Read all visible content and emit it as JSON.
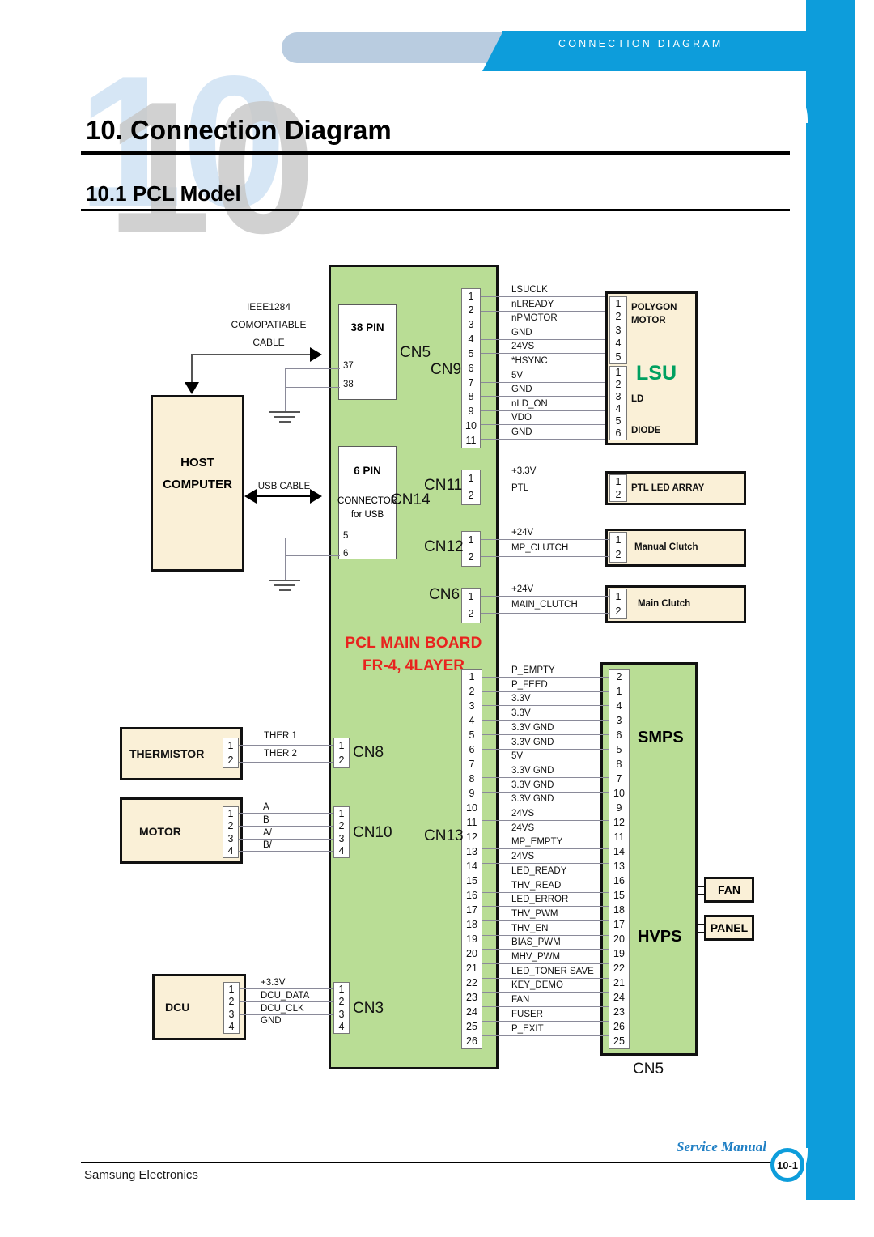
{
  "header": {
    "banner_text": "CONNECTION DIAGRAM",
    "watermark": "10",
    "title": "10. Connection Diagram",
    "subtitle": "10.1 PCL Model"
  },
  "footer": {
    "company": "Samsung Electronics",
    "manual": "Service Manual",
    "page": "10-1"
  },
  "board": {
    "title": "PCL MAIN BOARD",
    "subtitle": "FR-4, 4LAYER",
    "connectors": {
      "cn5_38pin": {
        "label": "38 PIN",
        "tag": "CN5",
        "extra_pins": [
          "37",
          "38"
        ]
      },
      "cn14_6pin": {
        "label": "6 PIN",
        "sub1": "CONNECTOR",
        "sub2": "for USB",
        "tag": "CN14",
        "extra_pins": [
          "5",
          "6"
        ]
      },
      "cn9": {
        "tag": "CN9",
        "pins": [
          "1",
          "2",
          "3",
          "4",
          "5",
          "6",
          "7",
          "8",
          "9",
          "10",
          "11"
        ]
      },
      "cn11": {
        "tag": "CN11",
        "pins": [
          "1",
          "2"
        ]
      },
      "cn12": {
        "tag": "CN12",
        "pins": [
          "1",
          "2"
        ]
      },
      "cn6": {
        "tag": "CN6",
        "pins": [
          "1",
          "2"
        ]
      },
      "cn8": {
        "tag": "CN8",
        "pins": [
          "1",
          "2"
        ]
      },
      "cn10": {
        "tag": "CN10",
        "pins": [
          "1",
          "2",
          "3",
          "4"
        ]
      },
      "cn3": {
        "tag": "CN3",
        "pins": [
          "1",
          "2",
          "3",
          "4"
        ]
      },
      "cn13": {
        "tag": "CN13",
        "pins": [
          "1",
          "2",
          "3",
          "4",
          "5",
          "6",
          "7",
          "8",
          "9",
          "10",
          "11",
          "12",
          "13",
          "14",
          "15",
          "16",
          "17",
          "18",
          "19",
          "20",
          "21",
          "22",
          "23",
          "24",
          "25",
          "26"
        ]
      }
    }
  },
  "host": {
    "line1": "HOST",
    "line2": "COMPUTER",
    "parallel_cable": [
      "IEEE1284",
      "COMOPATIABLE",
      "CABLE"
    ],
    "usb_cable": "USB CABLE"
  },
  "lsu": {
    "title": "LSU",
    "title_color": "#00a060",
    "group1_label_l1": "POLYGON",
    "group1_label_l2": "MOTOR",
    "group1_pins": [
      "1",
      "2",
      "3",
      "4",
      "5"
    ],
    "group2_pins": [
      "1",
      "2",
      "3",
      "4",
      "5",
      "6"
    ],
    "label_ld": "LD",
    "label_diode": "DIODE",
    "signals": [
      "LSUCLK",
      "nLREADY",
      "nPMOTOR",
      "GND",
      "24VS",
      "*HSYNC",
      "5V",
      "GND",
      "nLD_ON",
      "VDO",
      "GND"
    ]
  },
  "ptl": {
    "name": "PTL LED ARRAY",
    "pins": [
      "1",
      "2"
    ],
    "signals": [
      "+3.3V",
      "PTL"
    ]
  },
  "manual_clutch": {
    "name": "Manual Clutch",
    "pins": [
      "1",
      "2"
    ],
    "signals": [
      "+24V",
      "MP_CLUTCH"
    ]
  },
  "main_clutch": {
    "name": "Main Clutch",
    "pins": [
      "1",
      "2"
    ],
    "signals": [
      "+24V",
      "MAIN_CLUTCH"
    ]
  },
  "thermistor": {
    "name": "THERMISTOR",
    "pins": [
      "1",
      "2"
    ],
    "signals": [
      "THER 1",
      "THER 2"
    ]
  },
  "motor": {
    "name": "MOTOR",
    "pins": [
      "1",
      "2",
      "3",
      "4"
    ],
    "signals": [
      "A",
      "B",
      "A/",
      "B/"
    ]
  },
  "dcu": {
    "name": "DCU",
    "pins": [
      "1",
      "2",
      "3",
      "4"
    ],
    "signals": [
      "+3.3V",
      "DCU_DATA",
      "DCU_CLK",
      "GND"
    ]
  },
  "power_block": {
    "smps_label": "SMPS",
    "hvps_label": "HVPS",
    "tag": "CN5",
    "pins": [
      "2",
      "1",
      "4",
      "3",
      "6",
      "5",
      "8",
      "7",
      "10",
      "9",
      "12",
      "11",
      "14",
      "13",
      "16",
      "15",
      "18",
      "17",
      "20",
      "19",
      "22",
      "21",
      "24",
      "23",
      "26",
      "25"
    ],
    "signals": [
      "P_EMPTY",
      "P_FEED",
      "3.3V",
      "3.3V",
      "3.3V GND",
      "3.3V GND",
      "5V",
      "3.3V GND",
      "3.3V GND",
      "3.3V GND",
      "24VS",
      "24VS",
      "MP_EMPTY",
      "24VS",
      "LED_READY",
      "THV_READ",
      "LED_ERROR",
      "THV_PWM",
      "THV_EN",
      "BIAS_PWM",
      "MHV_PWM",
      "LED_TONER SAVE",
      "KEY_DEMO",
      "FAN",
      "FUSER",
      "P_EXIT"
    ]
  },
  "fan": {
    "name": "FAN"
  },
  "panel": {
    "name": "PANEL"
  }
}
